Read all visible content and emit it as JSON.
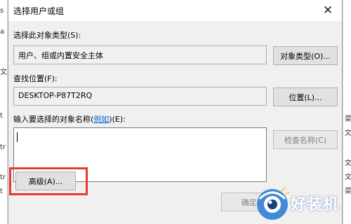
{
  "dialog": {
    "title": "选择用户或组",
    "close_glyph": "✕",
    "object_type_label": "选择此对象类型(S):",
    "object_type_value": "用户、组或内置安全主体",
    "object_type_button": "对象类型(O)...",
    "location_label": "查找位置(F):",
    "location_value": "DESKTOP-P87T2RQ",
    "location_button": "位置(L)...",
    "names_label_prefix": "输入要选择的对象名称(",
    "names_label_link": "例如",
    "names_label_suffix": ")(E):",
    "names_value": "",
    "check_names_button": "检查名称(C)",
    "advanced_button": "高级(A)...",
    "ok_button": "确定"
  },
  "background": {
    "left_fragments": [
      "s",
      "a",
      "文",
      "t",
      "tr",
      "tr",
      "t"
    ],
    "right_fragments": [
      "菜",
      "文",
      "文",
      "文",
      "菜"
    ]
  },
  "watermark": {
    "text": "好装机"
  },
  "colors": {
    "highlight": "#e53935",
    "dialog_bg": "#f0f0f0",
    "link": "#0066cc"
  }
}
